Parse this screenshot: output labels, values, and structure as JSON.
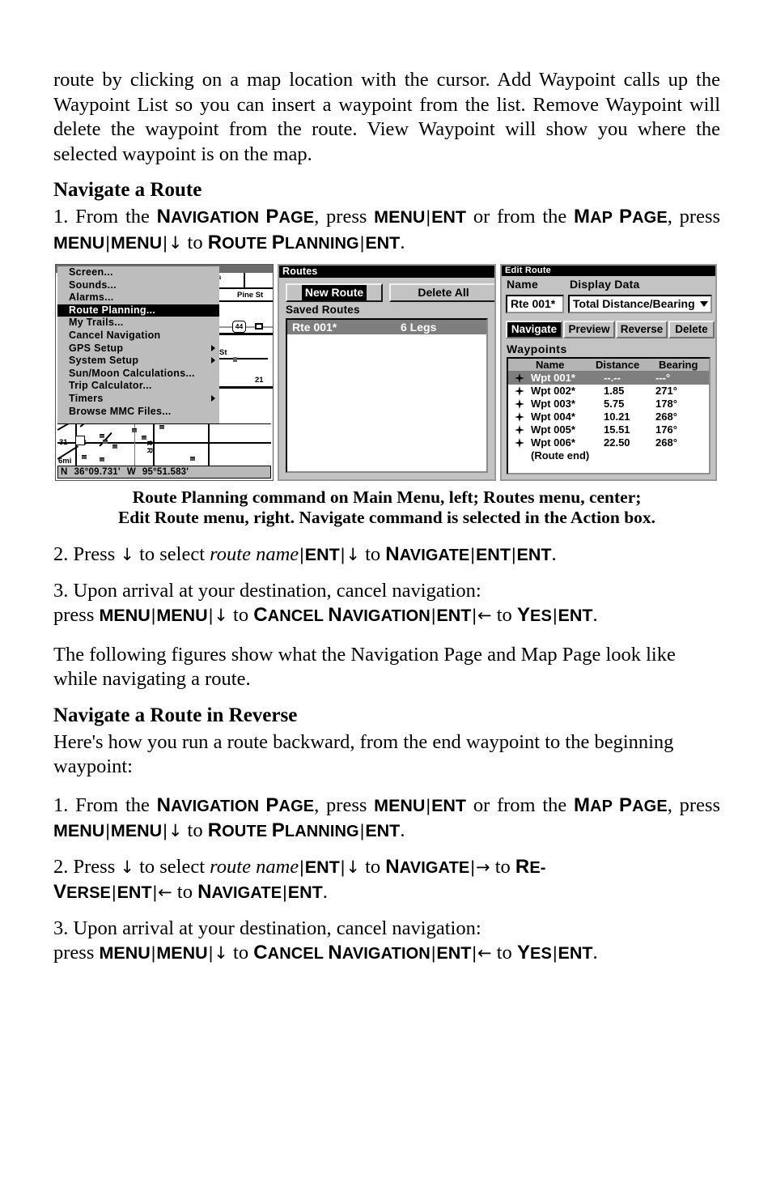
{
  "document": {
    "intro_paragraph": "route by clicking on a map location with the cursor. Add Waypoint calls up the Waypoint List so you can insert a waypoint from the list. Remove Waypoint will delete the waypoint from the route. View Waypoint will show you where the selected waypoint is on the map.",
    "section1_heading": "Navigate a Route",
    "section2_heading": "Navigate a Route in Reverse",
    "middle_paragraph": "The following figures show what the Navigation Page and Map Page look like while navigating a route.",
    "reverse_intro": "Here's how you run a route backward, from the end waypoint to the beginning waypoint:",
    "caption_line1": "Route Planning command on Main Menu, left; Routes  menu, center;",
    "caption_line2": "Edit Route menu, right. Navigate command is selected in the Action box."
  },
  "steps": {
    "s1_num": "1.",
    "s1_a": "From the",
    "s1_nav_page": "Navigation Page",
    "s1_b": ", press",
    "s1_menu": "MENU",
    "s1_ent": "ENT",
    "s1_c": "or from the",
    "s1_map_page": "Map Page",
    "s1_d": ", press",
    "s1_menu2": "MENU",
    "s1_menu3": "MENU",
    "s1_down": "↓",
    "s1_to": "to",
    "s1_route_planning": "Route Planning",
    "s1_ent2": "ENT",
    "s1_period": ".",
    "s2_num": "2.",
    "s2_press": "Press",
    "s2_down": "↓",
    "s2_select": "to select",
    "s2_routename": "route name",
    "s2_ent": "ENT",
    "s2_down2": "↓",
    "s2_to": "to",
    "s2_navigate": "Navigate",
    "s2_ent2": "ENT",
    "s2_ent3": "ENT",
    "s2_period": ".",
    "s3_num": "3.",
    "s3_line1": "Upon arrival at your destination, cancel navigation:",
    "s3_press": "press",
    "s3_menu": "MENU",
    "s3_menu2": "MENU",
    "s3_down": "↓",
    "s3_to": "to",
    "s3_cancel_nav": "Cancel Navigation",
    "s3_ent": "ENT",
    "s3_left": "←",
    "s3_to2": "to",
    "s3_yes": "Yes",
    "s3_ent2": "ENT",
    "s3_period": ".",
    "r2_num": "2.",
    "r2_press": "Press",
    "r2_down": "↓",
    "r2_select": "to select",
    "r2_routename": "route name",
    "r2_ent": "ENT",
    "r2_down2": "↓",
    "r2_to": "to",
    "r2_navigate": "Navigate",
    "r2_right": "→",
    "r2_to2": "to",
    "r2_reverse_a": "Re-",
    "r2_reverse_b": "verse",
    "r2_ent2": "ENT",
    "r2_left": "←",
    "r2_to3": "to",
    "r2_navigate2": "Navigate",
    "r2_ent3": "ENT",
    "r2_period": "."
  },
  "figure_main_menu": {
    "items": [
      {
        "label": "Screen...",
        "selected": false,
        "submenu": false
      },
      {
        "label": "Sounds...",
        "selected": false,
        "submenu": false
      },
      {
        "label": "Alarms...",
        "selected": false,
        "submenu": false
      },
      {
        "label": "Route Planning...",
        "selected": true,
        "submenu": false
      },
      {
        "label": "My Trails...",
        "selected": false,
        "submenu": false
      },
      {
        "label": "Cancel Navigation",
        "selected": false,
        "submenu": false
      },
      {
        "label": "GPS Setup",
        "selected": false,
        "submenu": true
      },
      {
        "label": "System Setup",
        "selected": false,
        "submenu": true
      },
      {
        "label": "Sun/Moon Calculations...",
        "selected": false,
        "submenu": false
      },
      {
        "label": "Trip Calculator...",
        "selected": false,
        "submenu": false
      },
      {
        "label": "Timers",
        "selected": false,
        "submenu": true
      },
      {
        "label": "Browse MMC Files...",
        "selected": false,
        "submenu": false
      }
    ],
    "status_lat_hem": "N",
    "status_lat": "36°09.731'",
    "status_lon_hem": "W",
    "status_lon": "95°51.583'",
    "map_labels": {
      "pine_st": "Pine St",
      "st": "St",
      "highway_shield": "44",
      "twentyone": "21",
      "thirty_first": "31",
      "thirty_first_st": "St",
      "scale": "6mi",
      "park_rd": "tt R"
    }
  },
  "figure_routes": {
    "title": "Routes",
    "new_route_button": "New Route",
    "delete_all_button": "Delete All",
    "saved_routes_label": "Saved Routes",
    "rows": [
      {
        "name": "Rte 001*",
        "legs": "6 Legs",
        "selected": true
      }
    ]
  },
  "figure_edit_route": {
    "title": "Edit Route",
    "name_label": "Name",
    "display_data_label": "Display Data",
    "name_value": "Rte 001*",
    "display_data_value": "Total Distance/Bearing",
    "actions": [
      {
        "label": "Navigate",
        "selected": true
      },
      {
        "label": "Preview",
        "selected": false
      },
      {
        "label": "Reverse",
        "selected": false
      },
      {
        "label": "Delete",
        "selected": false
      }
    ],
    "waypoints_label": "Waypoints",
    "columns": {
      "name": "Name",
      "distance": "Distance",
      "bearing": "Bearing"
    },
    "rows": [
      {
        "icon": "waypoint-icon",
        "name": "Wpt 001*",
        "distance": "--.--",
        "bearing": "---°",
        "selected": true
      },
      {
        "icon": "waypoint-icon",
        "name": "Wpt 002*",
        "distance": "1.85",
        "bearing": "271°",
        "selected": false
      },
      {
        "icon": "waypoint-icon",
        "name": "Wpt 003*",
        "distance": "5.75",
        "bearing": "178°",
        "selected": false
      },
      {
        "icon": "waypoint-icon",
        "name": "Wpt 004*",
        "distance": "10.21",
        "bearing": "268°",
        "selected": false
      },
      {
        "icon": "waypoint-icon",
        "name": "Wpt 005*",
        "distance": "15.51",
        "bearing": "176°",
        "selected": false
      },
      {
        "icon": "waypoint-icon",
        "name": "Wpt 006*",
        "distance": "22.50",
        "bearing": "268°",
        "selected": false
      }
    ],
    "route_end_label": "(Route end)"
  },
  "colors": {
    "gps_background": "#c3c3c3",
    "gps_selected": "#000000",
    "gps_row_selected": "#7e7e7e",
    "page_background": "#ffffff",
    "text": "#000000"
  }
}
